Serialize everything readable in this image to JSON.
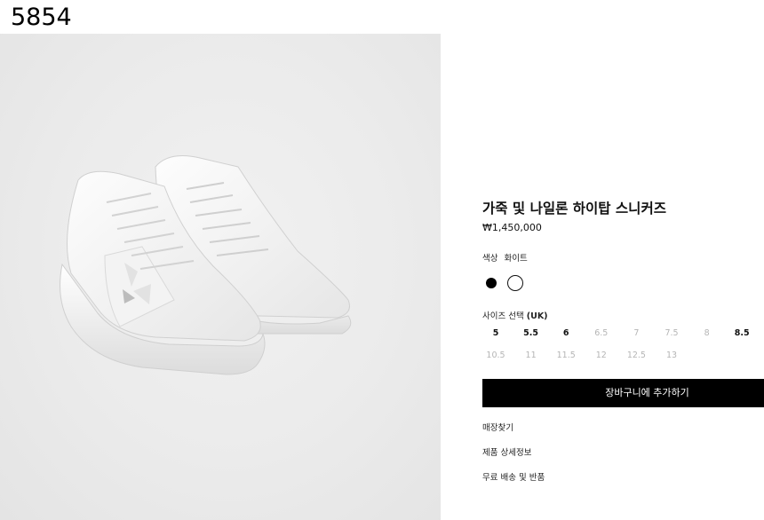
{
  "page_id": "5854",
  "product": {
    "title": "가죽 및 나일론 하이탑 스니커즈",
    "price": "₩1,450,000",
    "color_label": "색상",
    "color_value": "화이트",
    "colors": [
      "#000000",
      "#ffffff"
    ],
    "selected_color": "화이트"
  },
  "sizes": {
    "label": "사이즈 선택",
    "unit": "(UK)",
    "row1": [
      {
        "value": "5",
        "available": true
      },
      {
        "value": "5.5",
        "available": true
      },
      {
        "value": "6",
        "available": true
      },
      {
        "value": "6.5",
        "available": false
      },
      {
        "value": "7",
        "available": false
      },
      {
        "value": "7.5",
        "available": false
      },
      {
        "value": "8",
        "available": false
      },
      {
        "value": "8.5",
        "available": true
      }
    ],
    "row2": [
      {
        "value": "10.5",
        "available": false
      },
      {
        "value": "11",
        "available": false
      },
      {
        "value": "11.5",
        "available": false
      },
      {
        "value": "12",
        "available": false
      },
      {
        "value": "12.5",
        "available": false
      },
      {
        "value": "13",
        "available": false
      }
    ]
  },
  "actions": {
    "add_to_cart": "장바구니에 추가하기",
    "links": [
      "매장찾기",
      "제품 상세정보",
      "무료 배송 및 반품"
    ]
  }
}
